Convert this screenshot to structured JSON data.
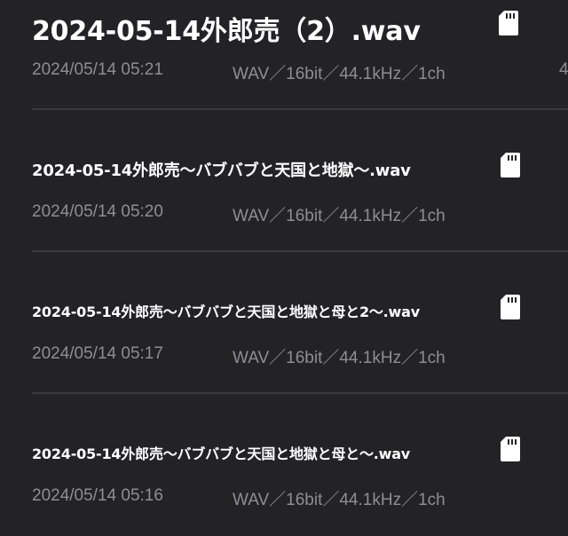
{
  "recordings": [
    {
      "title": "2024-05-14外郎売（2）.wav",
      "date": "2024/05/14 05:21",
      "format": "WAV／16bit／44.1kHz／1ch",
      "extra": "4",
      "storage_icon": "sd-card-icon"
    },
    {
      "title": "2024-05-14外郎売〜バブバブと天国と地獄〜.wav",
      "date": "2024/05/14 05:20",
      "format": "WAV／16bit／44.1kHz／1ch",
      "storage_icon": "sd-card-icon"
    },
    {
      "title": "2024-05-14外郎売〜バブバブと天国と地獄と母と2〜.wav",
      "date": "2024/05/14 05:17",
      "format": "WAV／16bit／44.1kHz／1ch",
      "storage_icon": "sd-card-icon"
    },
    {
      "title": "2024-05-14外郎売〜バブバブと天国と地獄と母と〜.wav",
      "date": "2024/05/14 05:16",
      "format": "WAV／16bit／44.1kHz／1ch",
      "storage_icon": "sd-card-icon"
    }
  ],
  "colors": {
    "background": "#232326",
    "title": "#ffffff",
    "meta": "#8e8e93",
    "divider": "#3a3a3e"
  }
}
